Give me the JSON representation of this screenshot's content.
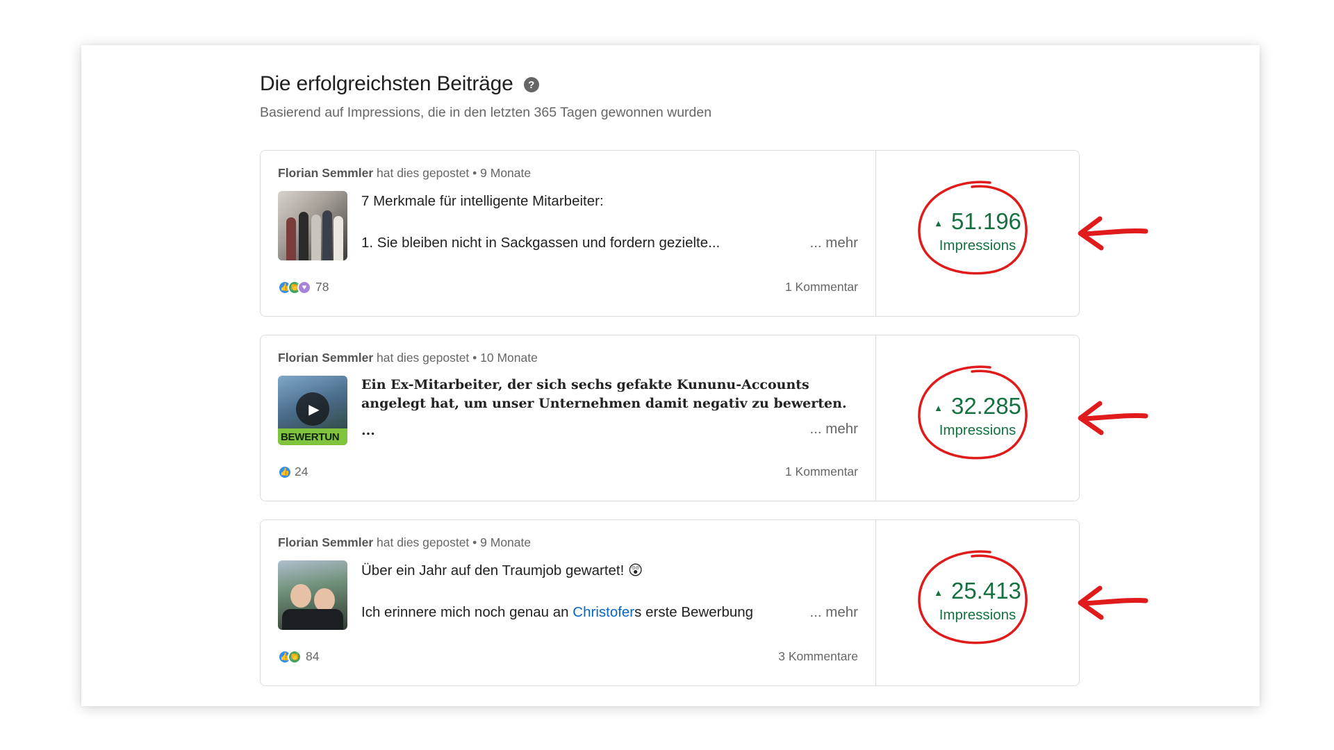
{
  "header": {
    "title": "Die erfolgreichsten Beiträge",
    "help_icon_glyph": "?",
    "subtitle": "Basierend auf Impressions, die in den letzten 365 Tagen gewonnen wurden"
  },
  "posts": [
    {
      "author": "Florian Semmler",
      "action": " hat dies gepostet • 9 Monate",
      "line1": "7 Merkmale für intelligente Mitarbeiter:",
      "line2": "1. Sie bleiben nicht in Sackgassen und fordern gezielte...",
      "more": "... mehr",
      "reactions_count": "78",
      "comments": "1 Kommentar",
      "impressions": "51.196",
      "impressions_label": "Impressions",
      "thumbnail_icon": "group-photo"
    },
    {
      "author": "Florian Semmler",
      "action": " hat dies gepostet • 10 Monate",
      "line1": "Ein Ex-Mitarbeiter, der sich sechs gefakte Kununu-Accounts angelegt hat, um unser Unternehmen damit negativ zu bewerten.",
      "ellipsis": "...",
      "more": "... mehr",
      "reactions_count": "24",
      "comments": "1 Kommentar",
      "impressions": "32.285",
      "impressions_label": "Impressions",
      "thumbnail_text": "BEWERTUN",
      "thumbnail_icon": "play-icon"
    },
    {
      "author": "Florian Semmler",
      "action": " hat dies gepostet • 9 Monate",
      "line1": "Über ein Jahr auf den Traumjob gewartet! 😲",
      "line2_before": "Ich erinnere mich noch genau an ",
      "line2_mention": "Christofer",
      "line2_after": "s erste Bewerbung",
      "more": "... mehr",
      "reactions_count": "84",
      "comments": "3 Kommentare",
      "impressions": "25.413",
      "impressions_label": "Impressions",
      "thumbnail_icon": "selfie-photo"
    }
  ],
  "colors": {
    "impressions_green": "#157140",
    "annotation_red": "#e01b1b",
    "mention_blue": "#0a66c2"
  }
}
